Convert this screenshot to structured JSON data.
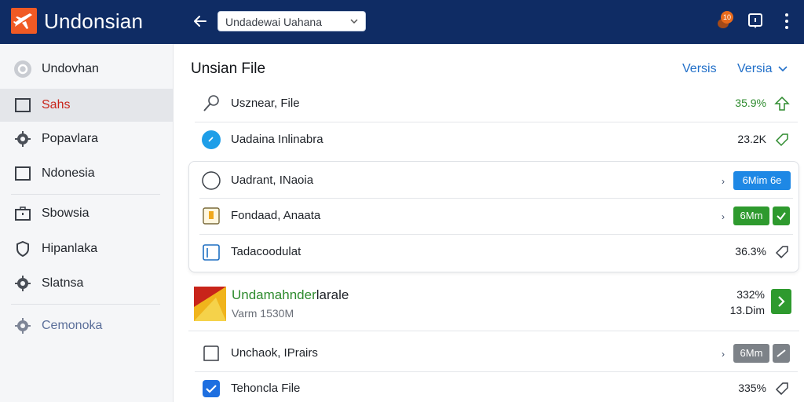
{
  "app": {
    "title": "Undonsian"
  },
  "topbar": {
    "select_value": "Undadewai Uahana",
    "notification_count": "10"
  },
  "sidebar": {
    "items": [
      {
        "label": "Undovhan",
        "icon": "gear-circle-icon"
      },
      {
        "label": "Sahs",
        "icon": "square-icon",
        "active": true
      },
      {
        "label": "Popavlara",
        "icon": "gear-icon"
      },
      {
        "label": "Ndonesia",
        "icon": "window-icon"
      },
      {
        "label": "Sbowsia",
        "icon": "briefcase-icon"
      },
      {
        "label": "Hipanlaka",
        "icon": "shield-icon"
      },
      {
        "label": "Slatnsa",
        "icon": "gear-icon"
      },
      {
        "label": "Cemonoka",
        "icon": "gear-icon"
      }
    ]
  },
  "main": {
    "title": "Unsian File",
    "view_links": [
      "Versis",
      "Versia"
    ],
    "rows": [
      {
        "label": "Usznear, File",
        "value": "35.9%",
        "icon": "search-icon"
      },
      {
        "label": "Uadaina Inlinabra",
        "value": "23.2K",
        "icon": "blue-dot-icon"
      }
    ],
    "card_rows": [
      {
        "label": "Uadrant, INaoia",
        "pill": "6Mim 6e"
      },
      {
        "label": "Fondaad, Anaata",
        "pill": "6Mm"
      },
      {
        "label": "Tadacoodulat",
        "value": "36.3%"
      }
    ],
    "feature": {
      "title_highlight": "Undamahnder",
      "title_rest": "larale",
      "subtitle": "Varm 1530M",
      "value1": "332%",
      "value2": "13.Dim"
    },
    "bottom_rows": [
      {
        "label": "Unchaok, IPrairs",
        "pill": "6Mm"
      },
      {
        "label": "Tehoncla File",
        "value": "335%"
      }
    ]
  },
  "colors": {
    "topbar": "#0f2c64",
    "accent_blue": "#1e88e5",
    "accent_green": "#2e9a2e",
    "active_text": "#c8241a",
    "logo": "#f05a24"
  }
}
